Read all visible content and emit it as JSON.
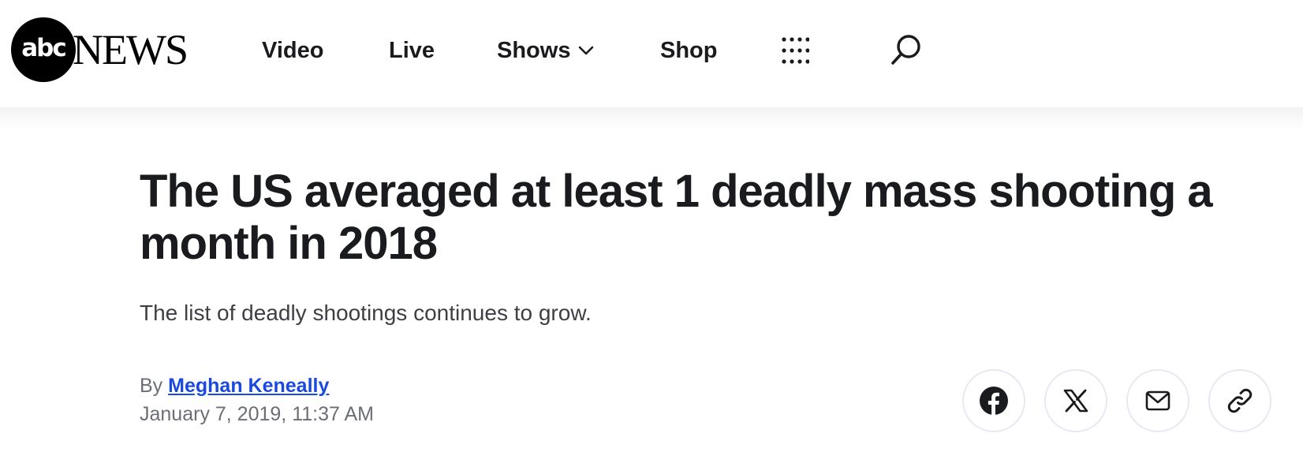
{
  "header": {
    "logo": {
      "mark": "abc",
      "word": "NEWS"
    },
    "nav": {
      "video": "Video",
      "live": "Live",
      "shows": "Shows",
      "shop": "Shop"
    },
    "icons": {
      "shows_dropdown": "chevron-down-icon",
      "more": "grid-dots-icon",
      "search": "search-icon"
    }
  },
  "article": {
    "headline": "The US averaged at least 1 deadly mass shooting a month in 2018",
    "dek": "The list of deadly shootings continues to grow.",
    "byline_prefix": "By",
    "author": "Meghan Keneally",
    "date": "January 7, 2019, 11:37 AM"
  },
  "share": {
    "icons": [
      "facebook-icon",
      "x-icon",
      "mail-icon",
      "link-icon"
    ]
  },
  "colors": {
    "text": "#1a1b1e",
    "author_link": "#1a49e0",
    "meta": "#6b6e75",
    "share_border": "#e6e9f2"
  }
}
